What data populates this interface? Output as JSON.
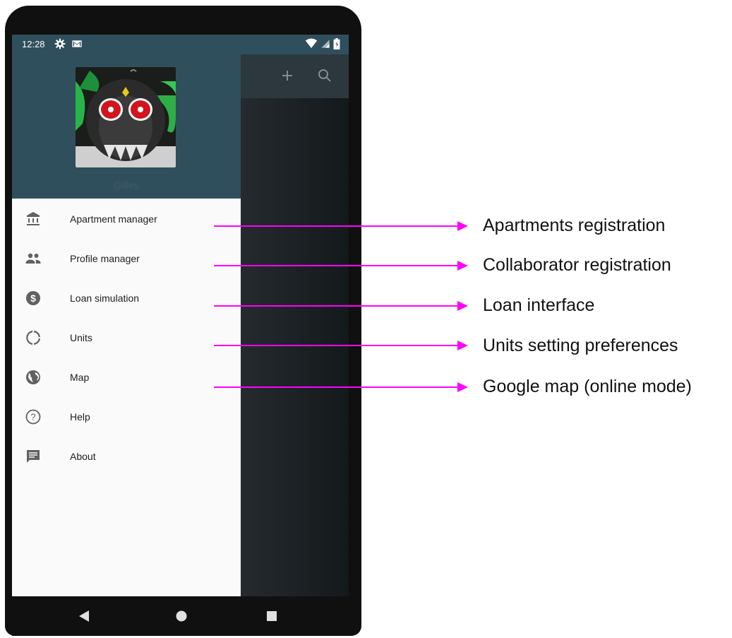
{
  "status_bar": {
    "time": "12:28",
    "left_icons": [
      "settings-icon",
      "gmail-icon"
    ],
    "right_icons": [
      "wifi-icon",
      "cellular-icon",
      "battery-icon"
    ]
  },
  "app_bar": {
    "actions": [
      "add-icon",
      "search-icon"
    ]
  },
  "drawer": {
    "user_name": "Gilles",
    "items": [
      {
        "label": "Apartment manager",
        "icon": "bank-icon"
      },
      {
        "label": "Profile manager",
        "icon": "people-icon"
      },
      {
        "label": "Loan simulation",
        "icon": "dollar-icon"
      },
      {
        "label": "Units",
        "icon": "units-icon"
      },
      {
        "label": "Map",
        "icon": "globe-icon"
      },
      {
        "label": "Help",
        "icon": "help-icon"
      },
      {
        "label": "About",
        "icon": "comment-icon"
      }
    ]
  },
  "nav_bar": {
    "buttons": [
      "back-icon",
      "home-icon",
      "recents-icon"
    ]
  },
  "annotations": [
    {
      "text": "Apartments registration"
    },
    {
      "text": "Collaborator registration"
    },
    {
      "text": "Loan interface"
    },
    {
      "text": "Units setting preferences"
    },
    {
      "text": "Google map (online mode)"
    }
  ],
  "colors": {
    "header": "#2f4f5d",
    "arrow": "#ff00ff",
    "icon": "#616161"
  }
}
